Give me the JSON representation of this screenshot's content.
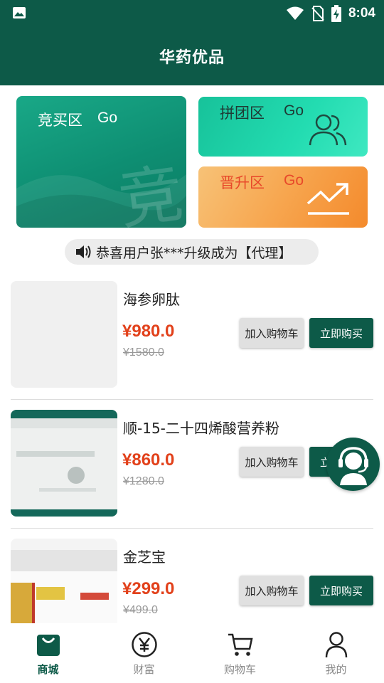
{
  "status_bar": {
    "time": "8:04"
  },
  "app_bar": {
    "title": "华药优品"
  },
  "banners": {
    "bid": {
      "label": "竞买区",
      "go": "Go",
      "watermark": "竞"
    },
    "group": {
      "label": "拼团区",
      "go": "Go"
    },
    "promotion": {
      "label": "晋升区",
      "go": "Go"
    }
  },
  "notice": {
    "text": "恭喜用户张***升级成为【代理】"
  },
  "products": [
    {
      "name": "海参卵肽",
      "price": "¥980.0",
      "original_price": "¥1580.0",
      "cart_label": "加入购物车",
      "buy_label": "立即购买"
    },
    {
      "name": "顺-15-二十四烯酸营养粉",
      "price": "¥860.0",
      "original_price": "¥1280.0",
      "cart_label": "加入购物车",
      "buy_label": "立即购买"
    },
    {
      "name": "金芝宝",
      "price": "¥299.0",
      "original_price": "¥499.0",
      "cart_label": "加入购物车",
      "buy_label": "立即购买"
    }
  ],
  "tab_bar": {
    "items": [
      {
        "label": "商城",
        "icon": "shopping-bag-icon",
        "active": true
      },
      {
        "label": "财富",
        "icon": "yen-coin-icon",
        "active": false
      },
      {
        "label": "购物车",
        "icon": "cart-icon",
        "active": false
      },
      {
        "label": "我的",
        "icon": "person-icon",
        "active": false
      }
    ]
  },
  "colors": {
    "primary": "#0d5a48",
    "price": "#e2411b",
    "bid_banner": "#0e8e72",
    "group_banner": "#23dcb1",
    "promo_banner": "#f7a64f"
  }
}
